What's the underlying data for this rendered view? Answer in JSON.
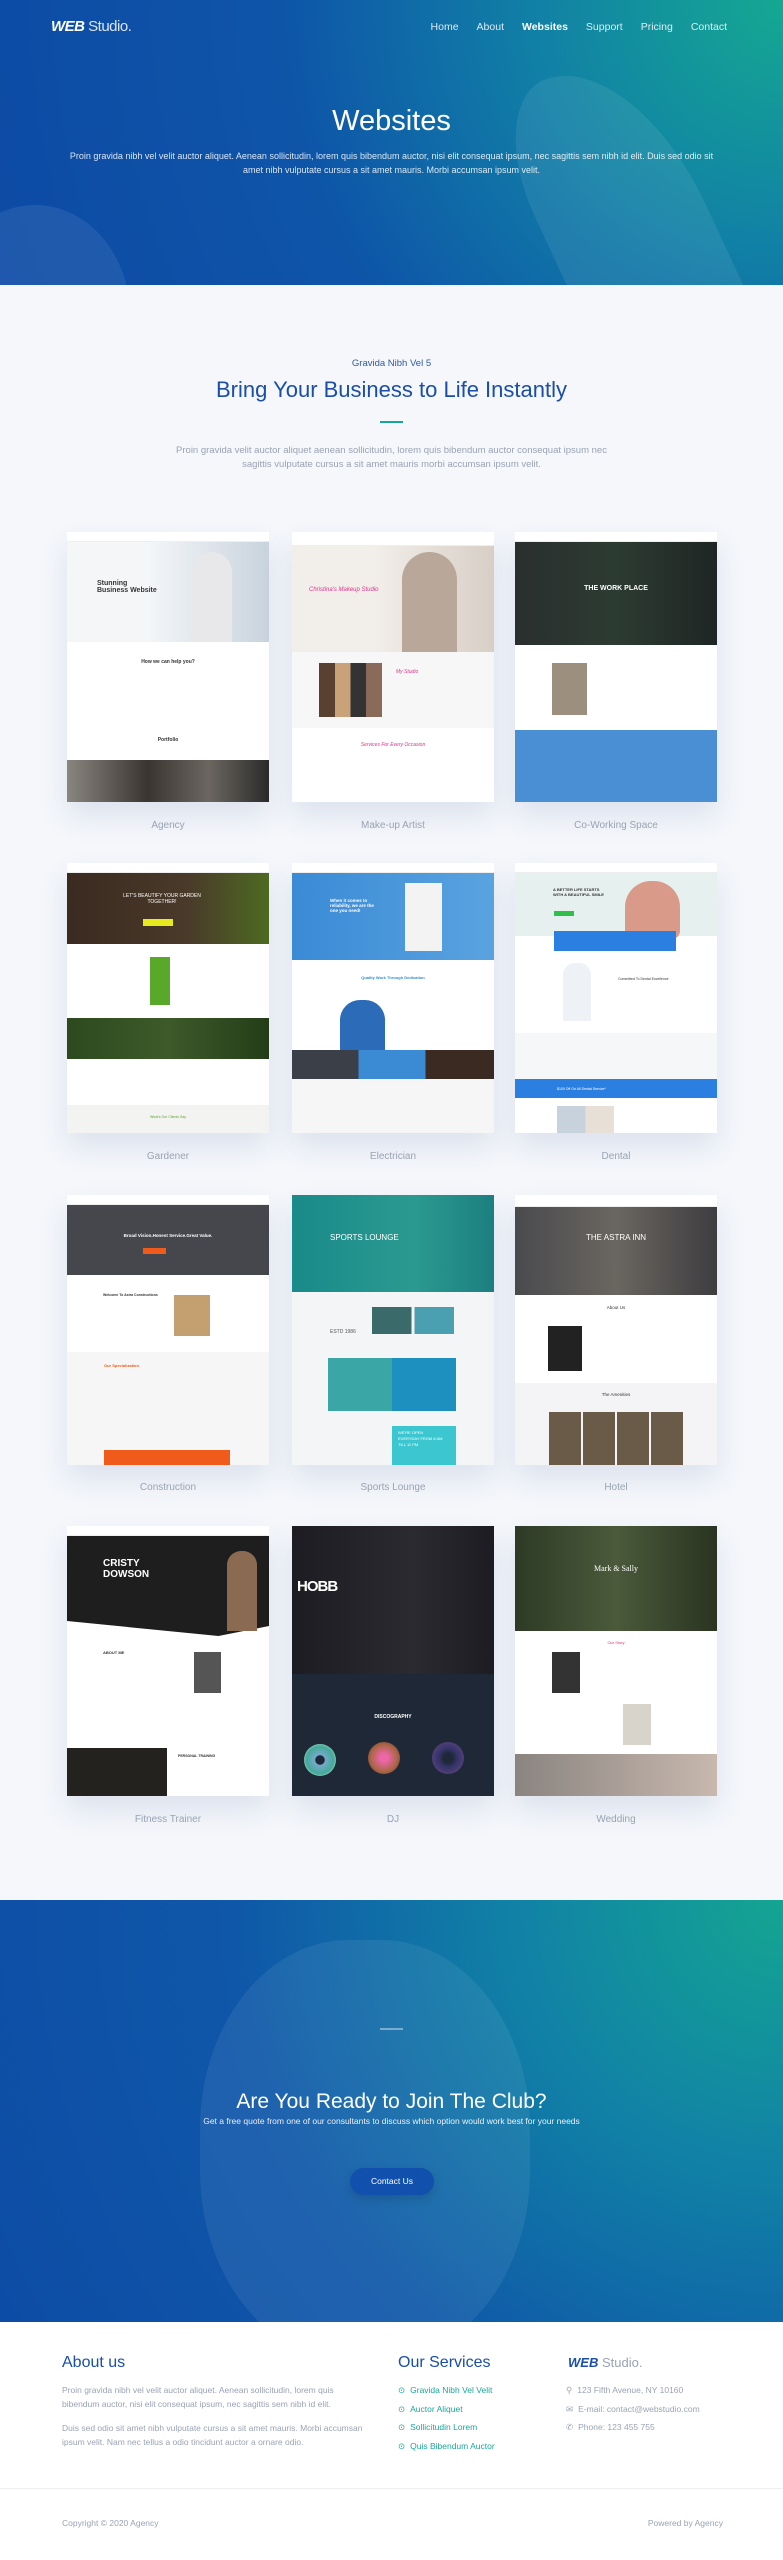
{
  "header": {
    "logo": {
      "mark": "WEB",
      "text": "Studio."
    },
    "nav": [
      {
        "label": "Home"
      },
      {
        "label": "About"
      },
      {
        "label": "Websites",
        "active": true
      },
      {
        "label": "Support"
      },
      {
        "label": "Pricing"
      },
      {
        "label": "Contact"
      }
    ],
    "title": "Websites",
    "description": "Proin gravida nibh vel velit auctor aliquet. Aenean sollicitudin, lorem quis bibendum auctor, nisi elit consequat ipsum, nec sagittis sem nibh id elit. Duis sed odio sit amet nibh vulputate cursus a sit amet mauris. Morbi accumsan ipsum velit."
  },
  "showcase": {
    "kicker": "Gravida Nibh Vel 5",
    "title": "Bring Your Business to Life Instantly",
    "intro": "Proin gravida velit auctor aliquet aenean sollicitudin, lorem quis bibendum auctor consequat ipsum nec sagittis vulputate cursus a sit amet mauris morbi accumsan ipsum velit.",
    "templates": [
      {
        "label": "Agency",
        "headline": "Stunning Business Website",
        "sub": "How we can help you?",
        "sub2": "Portfolio"
      },
      {
        "label": "Make-up Artist",
        "headline": "Christina's Makeup Studio",
        "sub": "My Studio",
        "sub2": "Services For Every Occasion"
      },
      {
        "label": "Co-Working Space",
        "headline": "THE WORK PLACE"
      },
      {
        "label": "Gardener",
        "headline": "LET'S BEAUTIFY YOUR GARDEN TOGETHER!",
        "sub": "What's Our Clients Say"
      },
      {
        "label": "Electrician",
        "headline": "When it comes to reliability, we are the one you need!",
        "sub": "Quality Work Through Dedication"
      },
      {
        "label": "Dental",
        "headline": "A BETTER LIFE STARTS WITH A BEAUTIFUL SMILE",
        "sub": "Committed To Dental Excellence",
        "sub2": "$100 Off On All Dental Service*"
      },
      {
        "label": "Construction",
        "headline": "Broad Vision.Honest Service.Great Value.",
        "sub": "Welcome To Astra Constructions",
        "sub2": "Our Specialization"
      },
      {
        "label": "Sports Lounge",
        "headline": "SPORTS LOUNGE",
        "sub": "ESTD 1986",
        "sub2": "WE'RE OPEN EVERYDAY FROM 8 AM TILL 11 PM"
      },
      {
        "label": "Hotel",
        "headline": "THE ASTRA INN",
        "sub": "About Us",
        "sub2": "The Amenities"
      },
      {
        "label": "Fitness Trainer",
        "headline": "CRISTY DOWSON",
        "sub": "ABOUT ME",
        "sub2": "PERSONAL TRAINING"
      },
      {
        "label": "DJ",
        "headline": "HOBB",
        "sub": "DISCOGRAPHY"
      },
      {
        "label": "Wedding",
        "headline": "Mark & Sally",
        "sub": "Our Story"
      }
    ]
  },
  "cta": {
    "title": "Are You Ready to Join The Club?",
    "text": "Get a free quote from one of our consultants to discuss which option would work best for your needs",
    "button": "Contact Us"
  },
  "footer": {
    "about": {
      "title": "About us",
      "p1": "Proin gravida nibh vel velit auctor aliquet. Aenean sollicitudin, lorem quis bibendum auctor, nisi elit consequat ipsum, nec sagittis sem nibh id elit.",
      "p2": "Duis sed odio sit amet nibh vulputate cursus a sit amet mauris. Morbi accumsan ipsum velit. Nam nec tellus a odio tincidunt auctor a ornare odio."
    },
    "services": {
      "title": "Our Services",
      "items": [
        "Gravida Nibh Vel Velit",
        "Auctor Aliquet",
        "Sollicitudin Lorem",
        "Quis Bibendum Auctor"
      ]
    },
    "contact": {
      "logo_mark": "WEB",
      "logo_text": "Studio.",
      "address": "123 Fifth Avenue, NY 10160",
      "email": "E-mail: contact@webstudio.com",
      "phone": "Phone: 123 455 755"
    },
    "copyright": "Copyright © 2020 Agency",
    "powered": "Powered by Agency"
  },
  "colors": {
    "primary": "#1a4ea8",
    "accent": "#1aa69a",
    "background": "#f5f7fb"
  }
}
